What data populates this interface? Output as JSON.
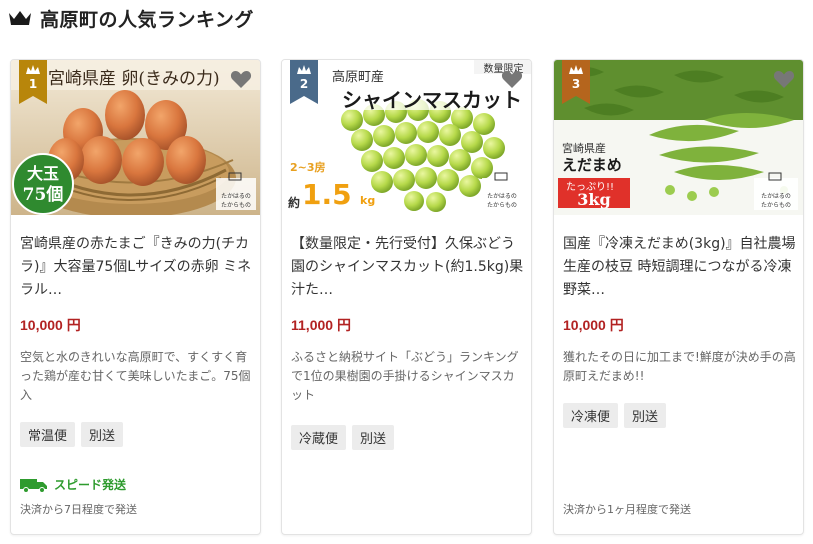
{
  "header": {
    "title": "高原町の人気ランキング"
  },
  "cards": [
    {
      "rank": "1",
      "rank_color": "#b8860b",
      "image_banner": "州宮崎県産 卵(きみの力)",
      "image_badge_line1": "大玉",
      "image_badge_line2": "75個",
      "image_logo_line1": "たかはるの",
      "image_logo_line2": "たからもの",
      "title": "宮崎県産の赤たまご『きみの力(チカラ)』大容量75個Lサイズの赤卵 ミネラル…",
      "price": "10,000 円",
      "desc": "空気と水のきれいな高原町で、すくすく育った鶏が産む甘くて美味しいたまご。75個入",
      "tags": [
        "常温便",
        "別送"
      ],
      "speed": "スピード発送",
      "shipping": "決済から7日程度で発送"
    },
    {
      "rank": "2",
      "rank_color": "#4a6a8a",
      "image_tag": "数量限定",
      "image_origin": "高原町産",
      "image_name": "シャインマスカット",
      "image_weight_range": "2~3房",
      "image_weight_prefix": "約",
      "image_weight": "1.5",
      "image_weight_unit": "kg",
      "image_logo_line1": "たかはるの",
      "image_logo_line2": "たからもの",
      "title": "【数量限定・先行受付】久保ぶどう園のシャインマスカット(約1.5kg)果汁た…",
      "price": "11,000 円",
      "desc": "ふるさと納税サイト「ぶどう」ランキングで1位の果樹園の手掛けるシャインマスカット",
      "tags": [
        "冷蔵便",
        "別送"
      ]
    },
    {
      "rank": "3",
      "rank_color": "#b5651d",
      "image_origin": "宮崎県産",
      "image_name": "えだまめ",
      "image_label": "たっぷり!!",
      "image_weight": "3kg",
      "image_logo_line1": "たかはるの",
      "image_logo_line2": "たからもの",
      "title": "国産『冷凍えだまめ(3kg)』自社農場生産の枝豆 時短調理につながる冷凍野菜…",
      "price": "10,000 円",
      "desc": "獲れたその日に加工まで!鮮度が決め手の高原町えだまめ!!",
      "tags": [
        "冷凍便",
        "別送"
      ],
      "shipping": "決済から1ヶ月程度で発送"
    }
  ]
}
